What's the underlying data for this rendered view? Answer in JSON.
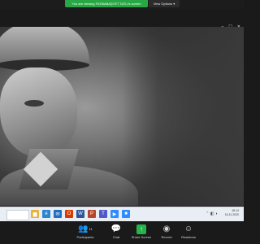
{
  "banner": {
    "sharing_text": "You are viewing FATMABAŞYET TATLI's screen",
    "view_options_label": "View Options ▾"
  },
  "taskbar": {
    "time": "18:14",
    "date": "16.11.2020",
    "apps": [
      "file-explorer",
      "edge",
      "mail",
      "office",
      "word",
      "powerpoint",
      "teams",
      "zoom",
      "zoom-meeting"
    ]
  },
  "toolbar": {
    "participants_label": "Participants",
    "participants_count": "11",
    "chat_label": "Chat",
    "share_label": "Share Screen",
    "record_label": "Record",
    "reactions_label": "Reactions"
  }
}
